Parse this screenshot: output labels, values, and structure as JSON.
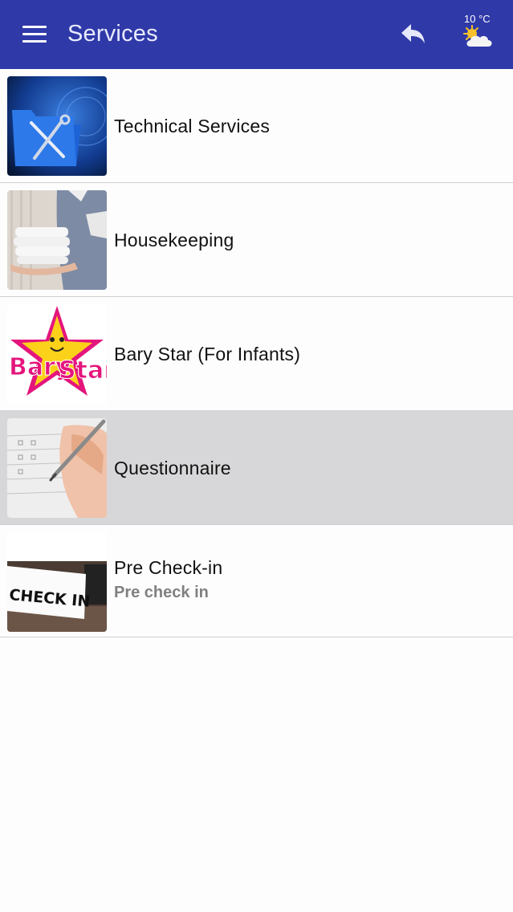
{
  "header": {
    "title": "Services",
    "weather_temp": "10 °C",
    "menu_icon": "hamburger-icon",
    "back_icon": "reply-arrow-icon",
    "weather_icon": "partly-cloudy-icon",
    "background_color": "#2f39a8"
  },
  "services": [
    {
      "title": "Technical Services",
      "subtitle": "",
      "thumbnail": "technical-services-image",
      "selected": false
    },
    {
      "title": "Housekeeping",
      "subtitle": "",
      "thumbnail": "housekeeping-image",
      "selected": false
    },
    {
      "title": "Bary Star (For Infants)",
      "subtitle": "",
      "thumbnail": "bary-star-logo-image",
      "logo_text": "Bary Star",
      "selected": false
    },
    {
      "title": "Questionnaire",
      "subtitle": "",
      "thumbnail": "questionnaire-image",
      "selected": true
    },
    {
      "title": "Pre Check-in",
      "subtitle": "Pre check in",
      "thumbnail": "check-in-image",
      "image_text": "CHECK IN",
      "selected": false
    }
  ],
  "colors": {
    "selected_row": "#d7d6d8",
    "divider": "#cfcfcf",
    "subtitle": "#808080"
  }
}
